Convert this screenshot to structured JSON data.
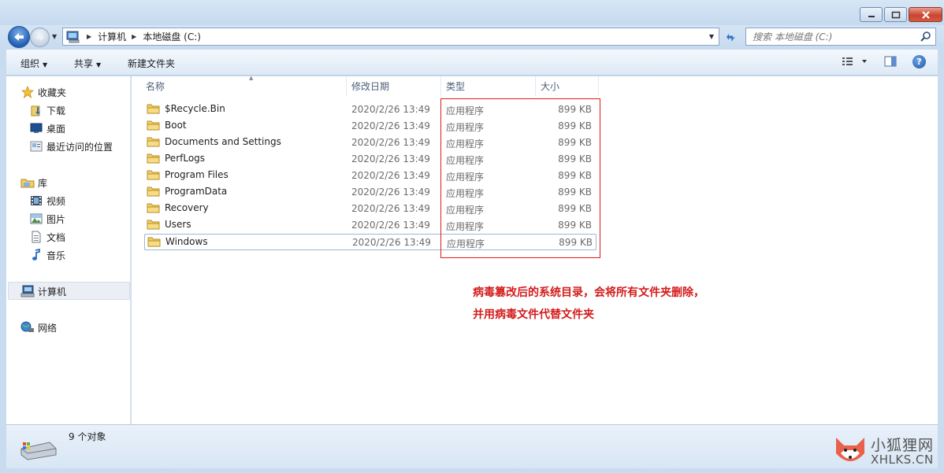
{
  "address": {
    "crumbs": [
      "计算机",
      "本地磁盘 (C:)"
    ]
  },
  "search": {
    "placeholder": "搜索 本地磁盘 (C:)"
  },
  "toolbar": {
    "organize": "组织",
    "share": "共享",
    "new_folder": "新建文件夹"
  },
  "sidebar": {
    "favorites": "收藏夹",
    "downloads": "下载",
    "desktop": "桌面",
    "recent": "最近访问的位置",
    "libraries": "库",
    "videos": "视频",
    "pictures": "图片",
    "documents": "文档",
    "music": "音乐",
    "computer": "计算机",
    "network": "网络"
  },
  "columns": {
    "name": "名称",
    "date": "修改日期",
    "type": "类型",
    "size": "大小"
  },
  "files": [
    {
      "name": "$Recycle.Bin",
      "date": "2020/2/26 13:49",
      "type": "应用程序",
      "size": "899 KB"
    },
    {
      "name": "Boot",
      "date": "2020/2/26 13:49",
      "type": "应用程序",
      "size": "899 KB"
    },
    {
      "name": "Documents and Settings",
      "date": "2020/2/26 13:49",
      "type": "应用程序",
      "size": "899 KB"
    },
    {
      "name": "PerfLogs",
      "date": "2020/2/26 13:49",
      "type": "应用程序",
      "size": "899 KB"
    },
    {
      "name": "Program Files",
      "date": "2020/2/26 13:49",
      "type": "应用程序",
      "size": "899 KB"
    },
    {
      "name": "ProgramData",
      "date": "2020/2/26 13:49",
      "type": "应用程序",
      "size": "899 KB"
    },
    {
      "name": "Recovery",
      "date": "2020/2/26 13:49",
      "type": "应用程序",
      "size": "899 KB"
    },
    {
      "name": "Users",
      "date": "2020/2/26 13:49",
      "type": "应用程序",
      "size": "899 KB"
    },
    {
      "name": "Windows",
      "date": "2020/2/26 13:49",
      "type": "应用程序",
      "size": "899 KB"
    }
  ],
  "annotation": {
    "line1": "病毒篡改后的系统目录，会将所有文件夹删除，",
    "line2": "并用病毒文件代替文件夹"
  },
  "status": {
    "count": "9 个对象"
  },
  "watermark": {
    "cn": "小狐狸网",
    "en": "XHLKS.CN"
  },
  "colors": {
    "annotation": "#d31c1c",
    "highlight_box": "#e01a1a"
  }
}
